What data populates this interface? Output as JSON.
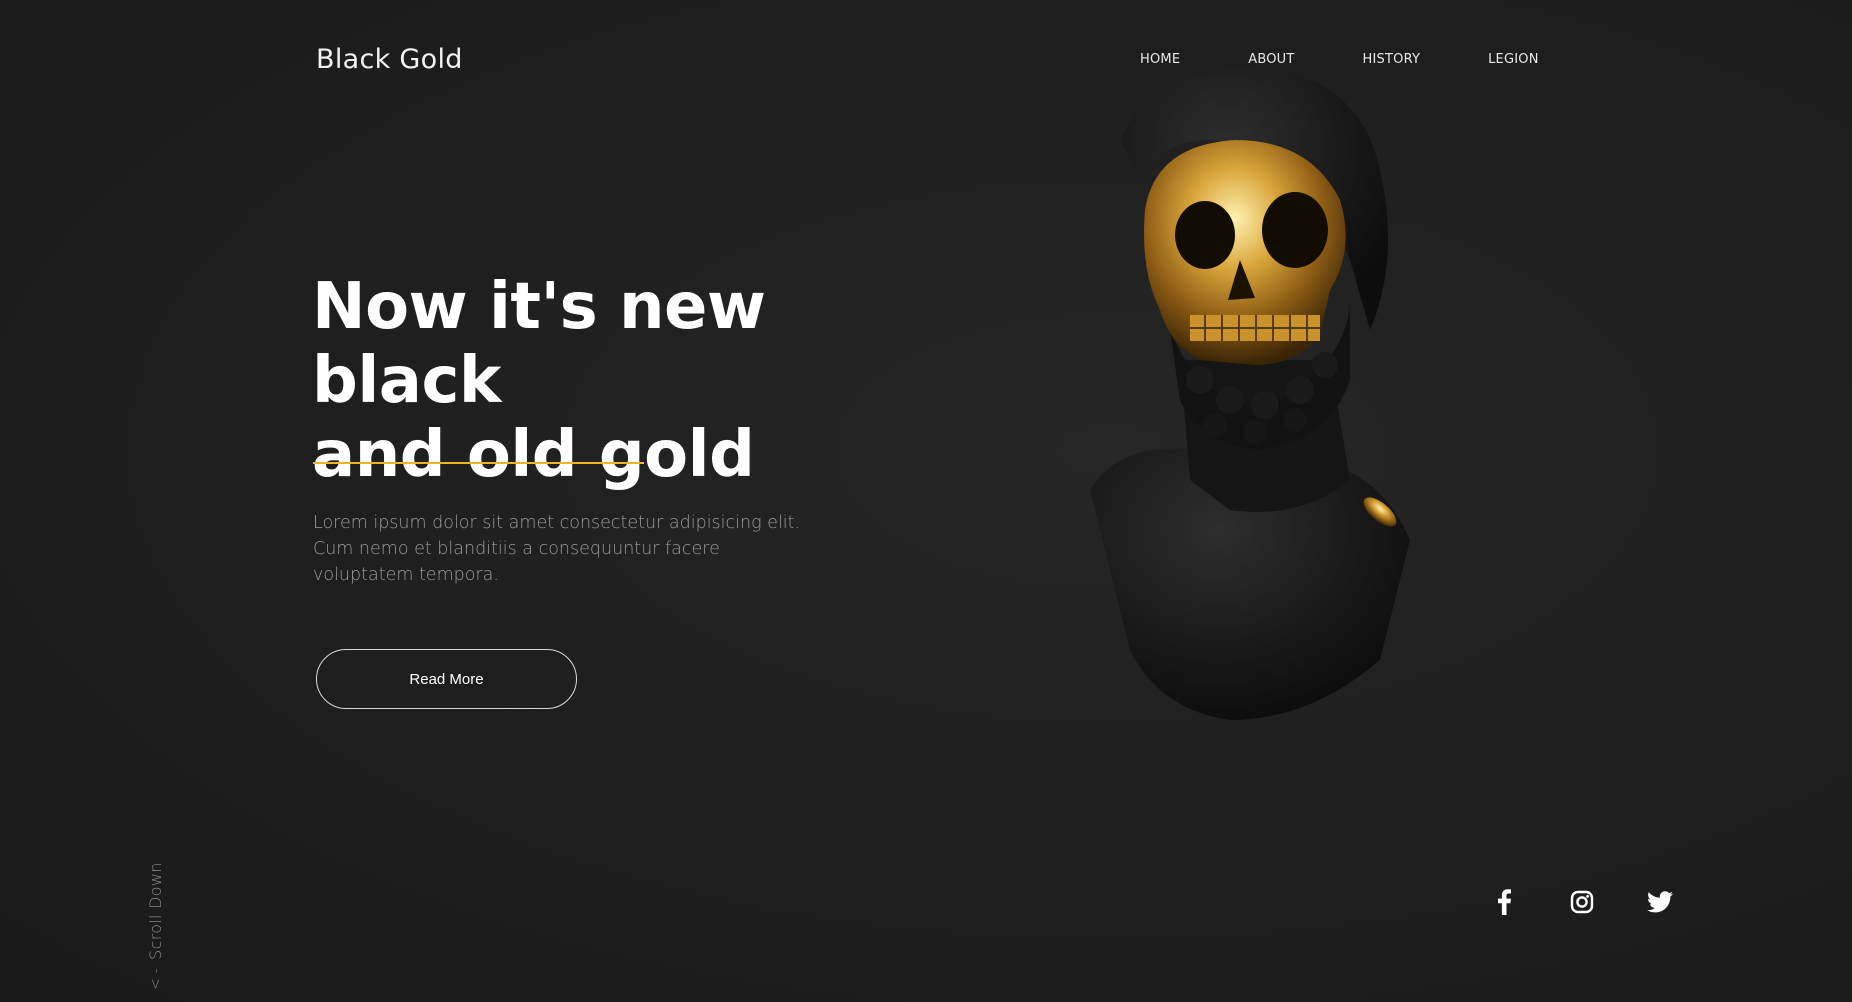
{
  "brand": {
    "name": "Black Gold"
  },
  "nav": {
    "items": [
      {
        "label": "HOME"
      },
      {
        "label": "ABOUT"
      },
      {
        "label": "HISTORY"
      },
      {
        "label": "LEGION"
      }
    ]
  },
  "hero": {
    "headline_line1": "Now it's new black",
    "headline_line2": "and old gold",
    "description": "Lorem ipsum dolor sit amet consectetur adipisicing elit. Cum nemo et blanditiis a consequuntur facere voluptatem tempora.",
    "cta_label": "Read More",
    "image_alt": "black bust with gold skull"
  },
  "scroll": {
    "label": "Scroll Down",
    "arrow": "< -"
  },
  "social": {
    "icons": [
      "facebook-icon",
      "instagram-icon",
      "twitter-icon"
    ]
  },
  "colors": {
    "background": "#1f1f1f",
    "accent": "#f0b429",
    "text": "#ffffff",
    "muted": "#9a9a9a"
  }
}
